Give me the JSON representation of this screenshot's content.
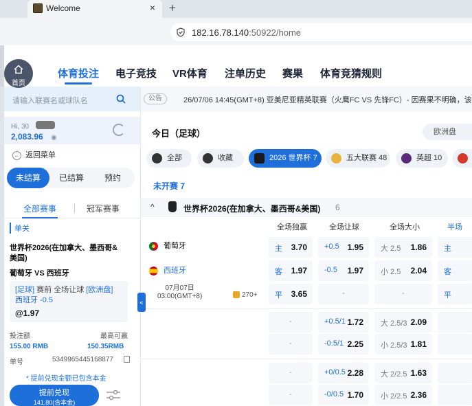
{
  "browser": {
    "tab_title": "Welcome",
    "close_glyph": "×",
    "newtab_glyph": "+",
    "url_host": "182.16.78.140",
    "url_rest": ":50922/home"
  },
  "header": {
    "home_label": "首页",
    "nav": [
      "体育投注",
      "电子竞技",
      "VR体育",
      "注单历史",
      "赛果",
      "体育竞猜规则"
    ]
  },
  "left": {
    "search_placeholder": "请输入联赛名或球队名",
    "greeting": "Hi, 30",
    "balance": "2,083.96",
    "back_label": "返回菜单",
    "segments": [
      "未结算",
      "已结算",
      "预约"
    ],
    "subtabs": [
      "全部赛事",
      "冠军赛事"
    ],
    "single_label": "单关",
    "bet": {
      "league": "世界杯2026(在加拿大、墨西哥&美国)",
      "match": "葡萄牙 VS 西班牙",
      "desc_pre": "[足球]",
      "desc_mid": " 赛前 全场让球 ",
      "desc_market": "[欧洲盘]",
      "desc_team": "西班牙 -0.5",
      "odds": "@1.97"
    },
    "stake_label": "投注额",
    "max_win_label": "最高可赢",
    "stake_value": "155.00 RMB",
    "max_win_value": "150.35RMB",
    "order_label": "单号",
    "order_no": "5349965445168877",
    "note": "* 提前兑现金额已包含本金",
    "cashout_title": "提前兑现",
    "cashout_amount": "141.80(含本金)"
  },
  "main": {
    "notice_badge": "公告",
    "notice_text": "26/07/06 14:45(GMT+8) 亚美尼亚精英联赛（火鹰FC VS 先锋FC）- 因赛果不明确，该",
    "today": "今日（足球）",
    "odds_format": "欧洲盘",
    "chips": [
      "全部",
      "收藏",
      "2026 世界杯 7",
      "五大联赛 48",
      "英超 10"
    ],
    "unstarted": "未开赛 7",
    "league_name": "世界杯2026(在加拿大、墨西哥&美国)",
    "league_count": "6",
    "columns": [
      "全场独赢",
      "全场让球",
      "全场大小",
      "半场"
    ],
    "home_team": "葡萄牙",
    "away_team": "西班牙",
    "match_date": "07月07日",
    "match_time": "03:00(GMT+8)",
    "more_bets": "270+",
    "dash": "-",
    "row1": {
      "l1": "主",
      "o1": "3.70",
      "l2": "+0.5",
      "o2": "1.95",
      "l3": "大 2.5",
      "o3": "1.86",
      "l4": "主"
    },
    "row2": {
      "l1": "客",
      "o1": "1.97",
      "l2": "-0.5",
      "o2": "1.97",
      "l3": "小 2.5",
      "o3": "2.04",
      "l4": "客"
    },
    "row3": {
      "l1": "平",
      "o1": "3.65",
      "l4": "平"
    },
    "row4": {
      "l2": "+0.5/1",
      "o2": "1.72",
      "l3": "大 2.5/3",
      "o3": "2.09"
    },
    "row5": {
      "l2": "-0.5/1",
      "o2": "2.25",
      "l3": "小 2.5/3",
      "o3": "1.81"
    },
    "row6": {
      "l2": "+0/0.5",
      "o2": "2.28",
      "l3": "大 2/2.5",
      "o3": "1.63"
    },
    "row7": {
      "l2": "-0/0.5",
      "o2": "1.70",
      "l3": "小 2/2.5",
      "o3": "2.36"
    }
  },
  "colors": {
    "accent": "#1e6fd9"
  }
}
